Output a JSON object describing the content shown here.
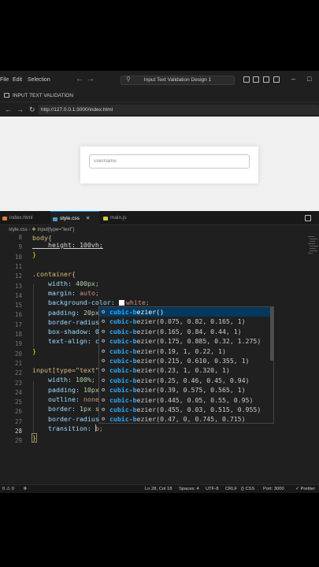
{
  "menu": {
    "file": "File",
    "edit": "Edit",
    "selection": "Selection"
  },
  "command_center": {
    "text": "Input Text Validation Design 1"
  },
  "browser": {
    "tab_label": "INPUT TEXT VALIDATION",
    "url": "http://127.0.0.1:3000/index.html"
  },
  "preview": {
    "placeholder": "username"
  },
  "editor_tabs": [
    {
      "label": "index.html",
      "color": "#e37933"
    },
    {
      "label": "style.css",
      "color": "#519aba"
    },
    {
      "label": "main.js",
      "color": "#cbcb41"
    }
  ],
  "breadcrumb": {
    "file": "style.css",
    "symbol": "input[type=\"text\"]"
  },
  "line_numbers": [
    "8",
    "9",
    "10",
    "11",
    "12",
    "13",
    "14",
    "15",
    "16",
    "17",
    "18",
    "19",
    "20",
    "21",
    "22",
    "23",
    "24",
    "25",
    "26",
    "27",
    "28",
    "29"
  ],
  "current_line": "28",
  "code": {
    "l8_sel": "body{",
    "l9_text": "    height: 100vh;",
    "l10_brace": "}",
    "l12_sel": ".container{",
    "l13_prop": "    width: ",
    "l13_val": "400px;",
    "l14_prop": "    margin: ",
    "l14_val": "auto;",
    "l15_prop": "    background-color: ",
    "l15_val": "white;",
    "l16_prop": "    padding: ",
    "l16_val": "20px",
    "l17_prop": "    border-radius",
    "l18_prop": "    box-shadow: 0",
    "l19_prop": "    text-align: c",
    "l20_brace": "}",
    "l22_sel": "input[type=\"text\"",
    "l23_prop": "    width: ",
    "l23_val": "100%;",
    "l24_prop": "    padding: ",
    "l24_val": "10px",
    "l25_prop": "    outline: ",
    "l25_val": "none",
    "l26_prop": "    border: ",
    "l26_val": "1px s",
    "l27_prop": "    border-radius",
    "l28_prop": "    transition: ",
    "l28_val": "b;",
    "l29_brace": "}"
  },
  "suggestions": [
    {
      "match": "cubic-b",
      "rest": "ezier()"
    },
    {
      "match": "cubic-b",
      "rest": "ezier(0.075, 0.82, 0.165, 1)"
    },
    {
      "match": "cubic-b",
      "rest": "ezier(0.165, 0.84, 0.44, 1)"
    },
    {
      "match": "cubic-b",
      "rest": "ezier(0.175, 0.885, 0.32, 1.275)"
    },
    {
      "match": "cubic-b",
      "rest": "ezier(0.19, 1, 0.22, 1)"
    },
    {
      "match": "cubic-b",
      "rest": "ezier(0.215, 0.610, 0.355, 1)"
    },
    {
      "match": "cubic-b",
      "rest": "ezier(0.23, 1, 0.320, 1)"
    },
    {
      "match": "cubic-b",
      "rest": "ezier(0.25, 0.46, 0.45, 0.94)"
    },
    {
      "match": "cubic-b",
      "rest": "ezier(0.39, 0.575, 0.565, 1)"
    },
    {
      "match": "cubic-b",
      "rest": "ezier(0.445, 0.05, 0.55, 0.95)"
    },
    {
      "match": "cubic-b",
      "rest": "ezier(0.455, 0.03, 0.515, 0.955)"
    },
    {
      "match": "cubic-b",
      "rest": "ezier(0.47, 0, 0.745, 0.715)"
    }
  ],
  "status": {
    "problems": "0 ⚠ 0",
    "ports": "0",
    "position": "Ln 28, Col 18",
    "spaces": "Spaces: 4",
    "encoding": "UTF-8",
    "eol": "CRLF",
    "language": "{} CSS",
    "port": "Port: 3000",
    "prettier": "✓ Prettier"
  },
  "colors": {
    "accent": "#0078d4",
    "editor_bg": "#1f1f1f",
    "suggest_active": "#04395e"
  }
}
